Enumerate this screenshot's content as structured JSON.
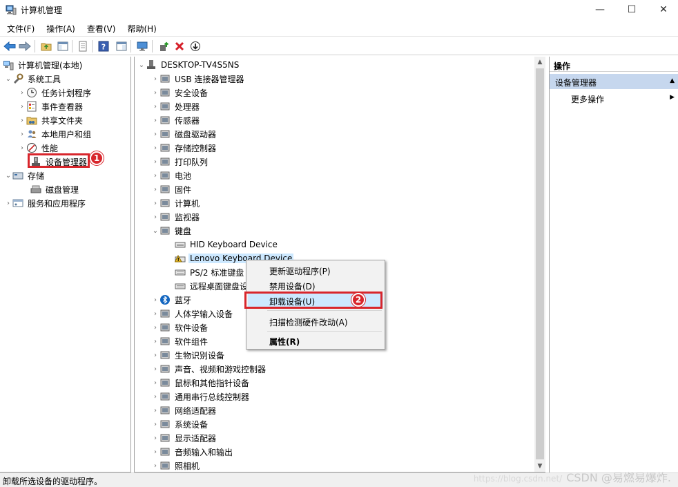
{
  "window": {
    "title": "计算机管理",
    "minimize": "—",
    "maximize": "☐",
    "close": "✕"
  },
  "menubar": [
    "文件(F)",
    "操作(A)",
    "查看(V)",
    "帮助(H)"
  ],
  "tree": {
    "root": "计算机管理(本地)",
    "system_tools": "系统工具",
    "task_scheduler": "任务计划程序",
    "event_viewer": "事件查看器",
    "shared_folders": "共享文件夹",
    "local_users": "本地用户和组",
    "performance": "性能",
    "device_manager": "设备管理器",
    "storage": "存储",
    "disk_management": "磁盘管理",
    "services_apps": "服务和应用程序"
  },
  "devices": {
    "computer_name": "DESKTOP-TV4S5NS",
    "categories": [
      "USB 连接器管理器",
      "安全设备",
      "处理器",
      "传感器",
      "磁盘驱动器",
      "存储控制器",
      "打印队列",
      "电池",
      "固件",
      "计算机",
      "监视器",
      "键盘"
    ],
    "keyboards": [
      "HID Keyboard Device",
      "Lenovo Keyboard Device",
      "PS/2 标准键盘",
      "远程桌面键盘设备"
    ],
    "categories_after": [
      "蓝牙",
      "人体学输入设备",
      "软件设备",
      "软件组件",
      "生物识别设备",
      "声音、视频和游戏控制器",
      "鼠标和其他指针设备",
      "通用串行总线控制器",
      "网络适配器",
      "系统设备",
      "显示适配器",
      "音频输入和输出",
      "照相机"
    ]
  },
  "context_menu": {
    "update_driver": "更新驱动程序(P)",
    "disable": "禁用设备(D)",
    "uninstall": "卸载设备(U)",
    "scan": "扫描检测硬件改动(A)",
    "properties": "属性(R)"
  },
  "actions": {
    "header": "操作",
    "section": "设备管理器",
    "more": "更多操作"
  },
  "annotations": {
    "badge1": "1",
    "badge2": "2",
    "accent": "#d8262c"
  },
  "status": "卸载所选设备的驱动程序。",
  "watermark": {
    "url": "https://blog.csdn.net/",
    "text": "CSDN @易燃易爆炸."
  }
}
